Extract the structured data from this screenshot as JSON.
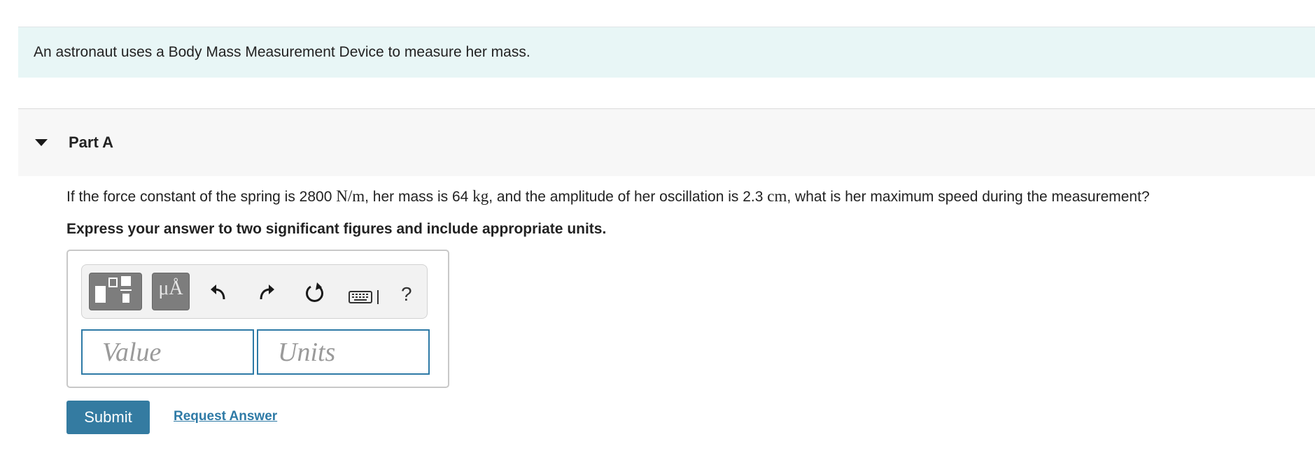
{
  "intro": {
    "text": "An astronaut uses a Body Mass Measurement Device to measure her mass."
  },
  "part": {
    "title": "Part A"
  },
  "question": {
    "segments": [
      "If the force constant of the spring is 2800 ",
      "N/m",
      ", her mass is 64 ",
      "kg",
      ", and the amplitude of her oscillation is 2.3 ",
      "cm",
      ", what is her maximum speed during the measurement?"
    ],
    "instruction": "Express your answer to two significant figures and include appropriate units."
  },
  "toolbar": {
    "units_symbol": "μÅ",
    "help_label": "?",
    "icons": [
      "templates-icon",
      "units-icon",
      "undo-icon",
      "redo-icon",
      "reset-icon",
      "keyboard-icon",
      "help-icon"
    ]
  },
  "answer": {
    "value_placeholder": "Value",
    "units_placeholder": "Units"
  },
  "actions": {
    "submit_label": "Submit",
    "request_label": "Request Answer"
  },
  "colors": {
    "intro_bg": "#e8f6f6",
    "accent": "#347ba1",
    "link": "#2e7aa6",
    "toolbar_button": "#7d7d7d"
  }
}
